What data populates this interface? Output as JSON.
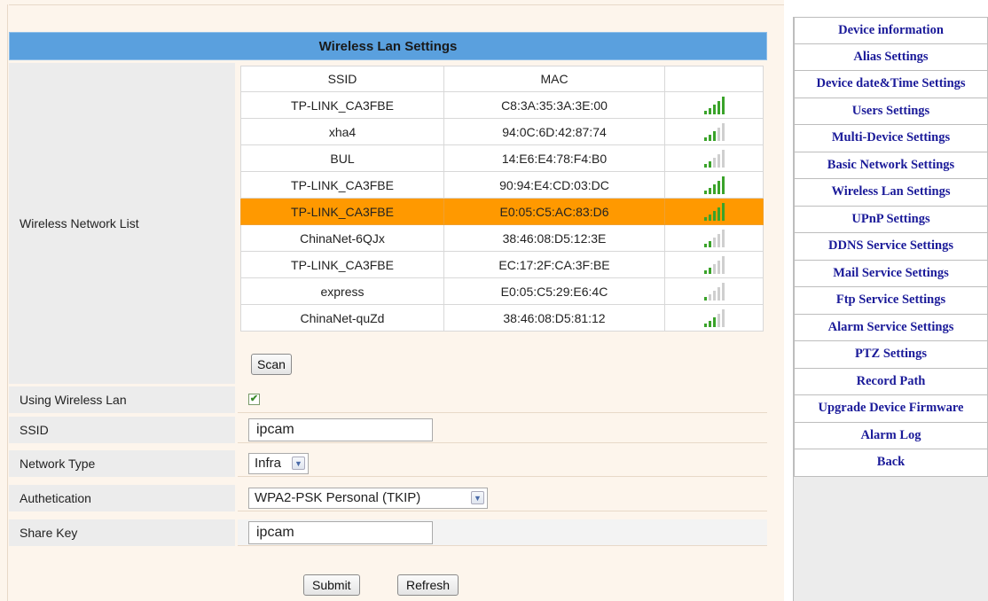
{
  "title": "Wireless Lan Settings",
  "network_list_label": "Wireless Network List",
  "table": {
    "headers": [
      "SSID",
      "MAC",
      ""
    ],
    "rows": [
      {
        "ssid": "TP-LINK_CA3FBE",
        "mac": "C8:3A:35:3A:3E:00",
        "signal_bars": 5,
        "selected": false
      },
      {
        "ssid": "xha4",
        "mac": "94:0C:6D:42:87:74",
        "signal_bars": 3,
        "selected": false
      },
      {
        "ssid": "BUL",
        "mac": "14:E6:E4:78:F4:B0",
        "signal_bars": 2,
        "selected": false
      },
      {
        "ssid": "TP-LINK_CA3FBE",
        "mac": "90:94:E4:CD:03:DC",
        "signal_bars": 5,
        "selected": false
      },
      {
        "ssid": "TP-LINK_CA3FBE",
        "mac": "E0:05:C5:AC:83:D6",
        "signal_bars": 5,
        "selected": true
      },
      {
        "ssid": "ChinaNet-6QJx",
        "mac": "38:46:08:D5:12:3E",
        "signal_bars": 2,
        "selected": false
      },
      {
        "ssid": "TP-LINK_CA3FBE",
        "mac": "EC:17:2F:CA:3F:BE",
        "signal_bars": 2,
        "selected": false
      },
      {
        "ssid": "express",
        "mac": "E0:05:C5:29:E6:4C",
        "signal_bars": 1,
        "selected": false
      },
      {
        "ssid": "ChinaNet-quZd",
        "mac": "38:46:08:D5:81:12",
        "signal_bars": 3,
        "selected": false
      }
    ]
  },
  "scan_label": "Scan",
  "form": {
    "using_wireless_label": "Using Wireless Lan",
    "using_wireless_checked": true,
    "ssid_label": "SSID",
    "ssid_value": "ipcam",
    "network_type_label": "Network Type",
    "network_type_value": "Infra",
    "auth_label": "Authetication",
    "auth_value": "WPA2-PSK Personal (TKIP)",
    "share_key_label": "Share Key",
    "share_key_value": "ipcam"
  },
  "buttons": {
    "submit": "Submit",
    "refresh": "Refresh"
  },
  "sidebar": {
    "items": [
      "Device information",
      "Alias Settings",
      "Device date&Time Settings",
      "Users Settings",
      "Multi-Device Settings",
      "Basic Network Settings",
      "Wireless Lan Settings",
      "UPnP Settings",
      "DDNS Service Settings",
      "Mail Service Settings",
      "Ftp Service Settings",
      "Alarm Service Settings",
      "PTZ Settings",
      "Record Path",
      "Upgrade Device Firmware",
      "Alarm Log",
      "Back"
    ]
  },
  "colors": {
    "title_bar": "#5aa0de",
    "selected_row": "#ff9900",
    "signal_on": "#3aa32a",
    "signal_off": "#cfcfcf",
    "sidebar_link": "#1a1a99"
  },
  "icons": {
    "signal": "signal-strength-icon",
    "checkbox": "checkbox-checked-icon",
    "dropdown": "chevron-down-icon"
  }
}
